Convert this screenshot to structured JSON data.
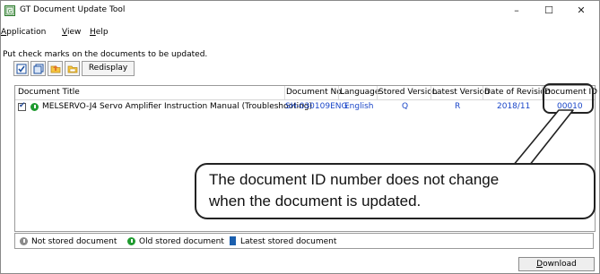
{
  "window": {
    "title": "GT Document Update Tool",
    "controls": {
      "minimize": "–",
      "maximize": "☐",
      "close": "✕"
    }
  },
  "menu": [
    {
      "label_first": "A",
      "label_rest": "pplication"
    },
    {
      "label_first": "V",
      "label_rest": "iew"
    },
    {
      "label_first": "H",
      "label_rest": "elp"
    }
  ],
  "instruction": "Put check marks on the documents to be updated.",
  "toolbar": {
    "buttons": [
      "check-all-icon",
      "uncheck-all-icon",
      "open-folder-icon",
      "folder-icon"
    ],
    "redisplay_label": "Redisplay"
  },
  "table": {
    "columns": [
      "Document Title",
      "Document No.",
      "Language",
      "Stored Version",
      "Latest Version",
      "Date of Revision",
      "Document ID"
    ],
    "rows": [
      {
        "checked": true,
        "status": "old-stored",
        "title": "MELSERVO-J4 Servo Amplifier Instruction Manual (Troubleshooting)",
        "document_no": "SH-030109ENG",
        "language": "English",
        "stored_version": "Q",
        "latest_version": "R",
        "date_of_revision": "2018/11",
        "document_id": "00010"
      }
    ]
  },
  "legend": [
    {
      "label": "Not stored document"
    },
    {
      "label": "Old stored document"
    },
    {
      "label": "Latest stored document"
    }
  ],
  "download_first": "D",
  "download_rest": "ownload",
  "callout": {
    "line1": "The document ID number does not change",
    "line2": "when the document is updated."
  },
  "colors": {
    "value_blue": "#1a46c8",
    "status_green": "#1f9a2f",
    "book_blue": "#1b5fae"
  }
}
